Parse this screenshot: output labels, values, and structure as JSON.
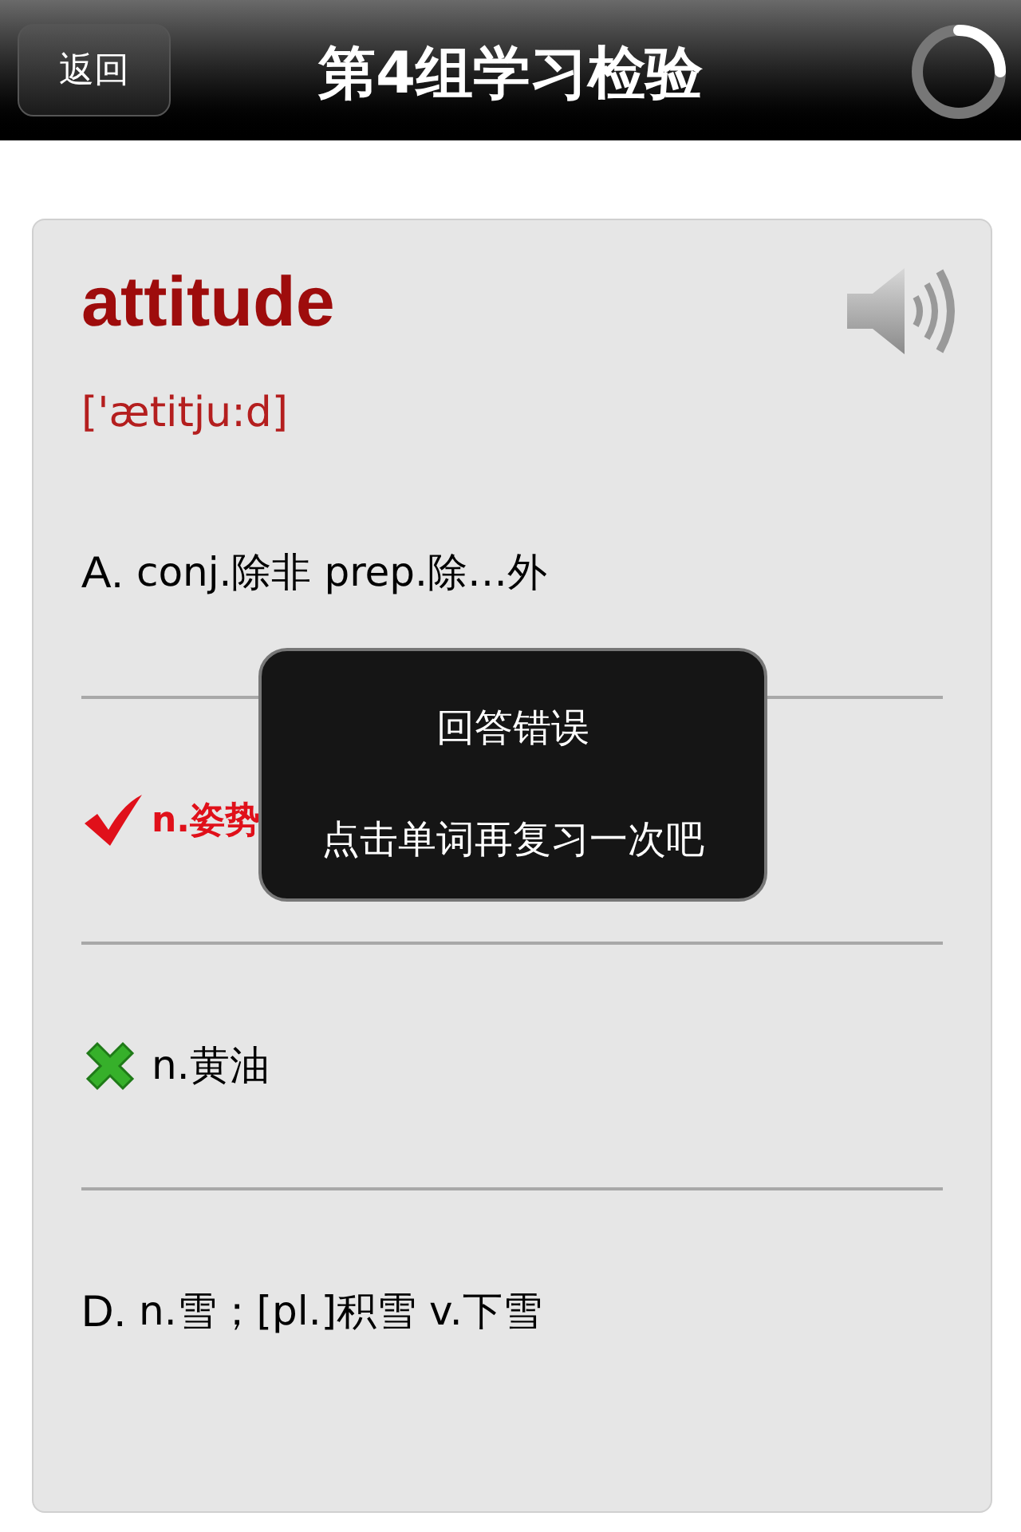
{
  "nav_bar": {
    "back_button": "返回",
    "title": "第4组学习检验"
  },
  "card": {
    "word": "attitude",
    "phonetic": "['ætitju:d]",
    "options": [
      {
        "kind": "letter",
        "letter": "A.",
        "text": "conj.除非 prep.除…外"
      },
      {
        "kind": "correct",
        "text": "n.姿势"
      },
      {
        "kind": "wrong",
        "text": "n.黄油"
      },
      {
        "kind": "letter",
        "letter": "D.",
        "text": "n.雪；[pl.]积雪 v.下雪"
      }
    ]
  },
  "toast": {
    "title": "回答错误",
    "message": "点击单词再复习一次吧"
  }
}
